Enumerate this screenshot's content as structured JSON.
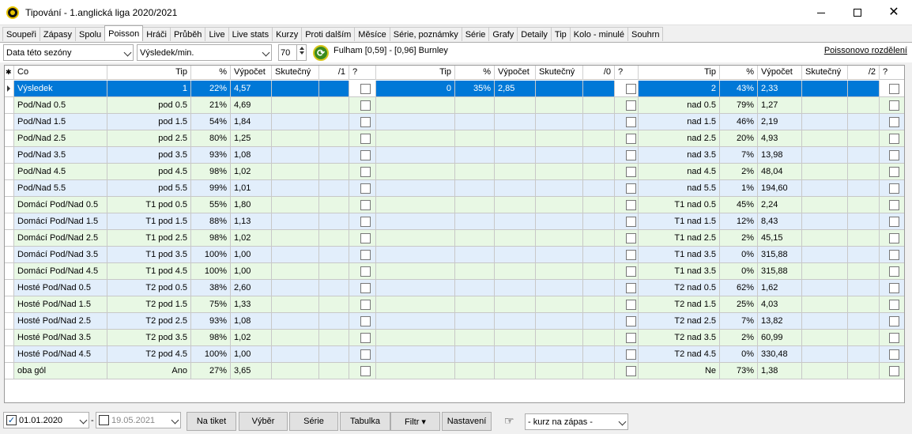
{
  "window": {
    "title": "Tipování - 1.anglická liga 2020/2021"
  },
  "tabs": [
    "Soupeři",
    "Zápasy",
    "Spolu",
    "Poisson",
    "Hráči",
    "Průběh",
    "Live",
    "Live stats",
    "Kurzy",
    "Proti dalším",
    "Měsíce",
    "Série, poznámky",
    "Série",
    "Grafy",
    "Detaily",
    "Tip",
    "Kolo - minulé",
    "Souhrn"
  ],
  "active_tab": "Poisson",
  "toolbar": {
    "data_select": "Data této sezóny",
    "result_select": "Výsledek/min.",
    "spin_value": "70",
    "match_text": "Fulham [0,59] - [0,96] Burnley",
    "poisson_link": "Poissonovo rozdělení"
  },
  "headers": {
    "star": "✱",
    "co": "Co",
    "g1": {
      "tip": "Tip",
      "pct": "%",
      "calc": "Výpočet",
      "actual": "Skutečný",
      "div": "/1",
      "q": "?"
    },
    "g0": {
      "tip": "Tip",
      "pct": "%",
      "calc": "Výpočet",
      "actual": "Skutečný",
      "div": "/0",
      "q": "?"
    },
    "g2": {
      "tip": "Tip",
      "pct": "%",
      "calc": "Výpočet",
      "actual": "Skutečný",
      "div": "/2",
      "q": "?"
    }
  },
  "rows": [
    {
      "co": "Výsledek",
      "tip1": "1",
      "pct1": "22%",
      "calc1": "4,57",
      "tip0": "0",
      "pct0": "35%",
      "calc0": "2,85",
      "tip2": "2",
      "pct2": "43%",
      "calc2": "2,33"
    },
    {
      "co": "Pod/Nad 0.5",
      "tip1": "pod 0.5",
      "pct1": "21%",
      "calc1": "4,69",
      "tip0": "",
      "pct0": "",
      "calc0": "",
      "tip2": "nad 0.5",
      "pct2": "79%",
      "calc2": "1,27"
    },
    {
      "co": "Pod/Nad 1.5",
      "tip1": "pod 1.5",
      "pct1": "54%",
      "calc1": "1,84",
      "tip0": "",
      "pct0": "",
      "calc0": "",
      "tip2": "nad 1.5",
      "pct2": "46%",
      "calc2": "2,19"
    },
    {
      "co": "Pod/Nad 2.5",
      "tip1": "pod 2.5",
      "pct1": "80%",
      "calc1": "1,25",
      "tip0": "",
      "pct0": "",
      "calc0": "",
      "tip2": "nad 2.5",
      "pct2": "20%",
      "calc2": "4,93"
    },
    {
      "co": "Pod/Nad 3.5",
      "tip1": "pod 3.5",
      "pct1": "93%",
      "calc1": "1,08",
      "tip0": "",
      "pct0": "",
      "calc0": "",
      "tip2": "nad 3.5",
      "pct2": "7%",
      "calc2": "13,98"
    },
    {
      "co": "Pod/Nad 4.5",
      "tip1": "pod 4.5",
      "pct1": "98%",
      "calc1": "1,02",
      "tip0": "",
      "pct0": "",
      "calc0": "",
      "tip2": "nad 4.5",
      "pct2": "2%",
      "calc2": "48,04"
    },
    {
      "co": "Pod/Nad 5.5",
      "tip1": "pod 5.5",
      "pct1": "99%",
      "calc1": "1,01",
      "tip0": "",
      "pct0": "",
      "calc0": "",
      "tip2": "nad 5.5",
      "pct2": "1%",
      "calc2": "194,60"
    },
    {
      "co": "Domácí Pod/Nad 0.5",
      "tip1": "T1 pod 0.5",
      "pct1": "55%",
      "calc1": "1,80",
      "tip0": "",
      "pct0": "",
      "calc0": "",
      "tip2": "T1 nad 0.5",
      "pct2": "45%",
      "calc2": "2,24"
    },
    {
      "co": "Domácí Pod/Nad 1.5",
      "tip1": "T1 pod 1.5",
      "pct1": "88%",
      "calc1": "1,13",
      "tip0": "",
      "pct0": "",
      "calc0": "",
      "tip2": "T1 nad 1.5",
      "pct2": "12%",
      "calc2": "8,43"
    },
    {
      "co": "Domácí Pod/Nad 2.5",
      "tip1": "T1 pod 2.5",
      "pct1": "98%",
      "calc1": "1,02",
      "tip0": "",
      "pct0": "",
      "calc0": "",
      "tip2": "T1 nad 2.5",
      "pct2": "2%",
      "calc2": "45,15"
    },
    {
      "co": "Domácí Pod/Nad 3.5",
      "tip1": "T1 pod 3.5",
      "pct1": "100%",
      "calc1": "1,00",
      "tip0": "",
      "pct0": "",
      "calc0": "",
      "tip2": "T1 nad 3.5",
      "pct2": "0%",
      "calc2": "315,88"
    },
    {
      "co": "Domácí Pod/Nad 4.5",
      "tip1": "T1 pod 4.5",
      "pct1": "100%",
      "calc1": "1,00",
      "tip0": "",
      "pct0": "",
      "calc0": "",
      "tip2": "T1 nad 3.5",
      "pct2": "0%",
      "calc2": "315,88"
    },
    {
      "co": "Hosté Pod/Nad 0.5",
      "tip1": "T2 pod 0.5",
      "pct1": "38%",
      "calc1": "2,60",
      "tip0": "",
      "pct0": "",
      "calc0": "",
      "tip2": "T2 nad 0.5",
      "pct2": "62%",
      "calc2": "1,62"
    },
    {
      "co": "Hosté Pod/Nad 1.5",
      "tip1": "T2 pod 1.5",
      "pct1": "75%",
      "calc1": "1,33",
      "tip0": "",
      "pct0": "",
      "calc0": "",
      "tip2": "T2 nad 1.5",
      "pct2": "25%",
      "calc2": "4,03"
    },
    {
      "co": "Hosté Pod/Nad 2.5",
      "tip1": "T2 pod 2.5",
      "pct1": "93%",
      "calc1": "1,08",
      "tip0": "",
      "pct0": "",
      "calc0": "",
      "tip2": "T2 nad 2.5",
      "pct2": "7%",
      "calc2": "13,82"
    },
    {
      "co": "Hosté Pod/Nad 3.5",
      "tip1": "T2 pod 3.5",
      "pct1": "98%",
      "calc1": "1,02",
      "tip0": "",
      "pct0": "",
      "calc0": "",
      "tip2": "T2 nad 3.5",
      "pct2": "2%",
      "calc2": "60,99"
    },
    {
      "co": "Hosté Pod/Nad 4.5",
      "tip1": "T2 pod 4.5",
      "pct1": "100%",
      "calc1": "1,00",
      "tip0": "",
      "pct0": "",
      "calc0": "",
      "tip2": "T2 nad 4.5",
      "pct2": "0%",
      "calc2": "330,48"
    },
    {
      "co": "oba gól",
      "tip1": "Ano",
      "pct1": "27%",
      "calc1": "3,65",
      "tip0": "",
      "pct0": "",
      "calc0": "",
      "tip2": "Ne",
      "pct2": "73%",
      "calc2": "1,38"
    }
  ],
  "bottom": {
    "date_from": "01.01.2020",
    "date_to": "19.05.2021",
    "buttons": [
      "Na tiket",
      "Výběr",
      "Série",
      "Tabulka",
      "Filtr ▾",
      "Nastavení"
    ],
    "kurz_select": "- kurz na zápas -"
  },
  "colors": {
    "row_green": "#e8f8e4",
    "row_blue": "#e2eefb",
    "selected": "#0078d7"
  }
}
